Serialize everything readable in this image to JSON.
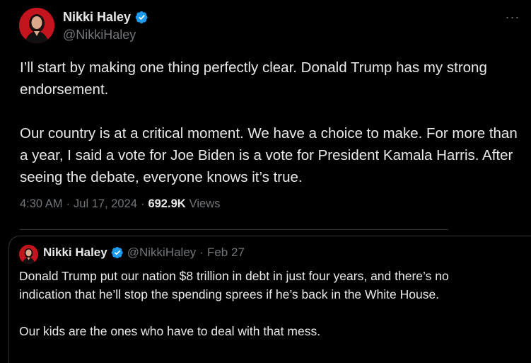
{
  "author": {
    "name": "Nikki Haley",
    "handle": "@NikkiHaley",
    "verified": true
  },
  "post": {
    "paragraphs": [
      "I’ll start by making one thing perfectly clear.  Donald Trump has my strong endorsement.",
      "Our country is at a critical moment.  We have a choice to make.  For more than a year, I said a vote for Joe Biden is a vote for President Kamala Harris.  After seeing the debate, everyone knows it’s true."
    ],
    "time": "4:30 AM",
    "date": "Jul 17, 2024",
    "separator": "·",
    "views_count": "692.9K",
    "views_label": "Views"
  },
  "quoted": {
    "name": "Nikki Haley",
    "handle": "@NikkiHaley",
    "separator": "·",
    "date": "Feb 27",
    "paragraphs": [
      "Donald Trump put our nation $8 trillion in debt in just four years, and there’s no indication that he’ll stop the spending sprees if he’s back in the White House.",
      "Our kids are the ones who have to deal with that mess."
    ]
  },
  "colors": {
    "background": "#000000",
    "text_primary": "#e7e9ea",
    "text_secondary": "#71767b",
    "verified_blue": "#1d9bf0",
    "border": "#2f3336"
  },
  "icons": {
    "verified": "verified-badge-icon",
    "more": "more-options-icon"
  }
}
